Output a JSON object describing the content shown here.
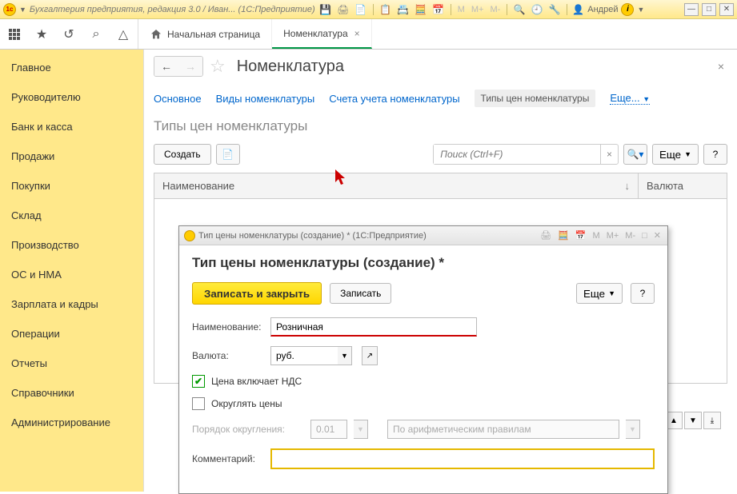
{
  "titlebar": {
    "title": "Бухгалтерия предприятия, редакция 3.0 / Иван...  (1С:Предприятие)",
    "user": "Андрей",
    "m_buttons": [
      "M",
      "M+",
      "M-"
    ]
  },
  "toolbar": {
    "star": "★",
    "search": "⌕",
    "bell": "🔔"
  },
  "tabs": {
    "home": "Начальная страница",
    "active": "Номенклатура"
  },
  "sidebar": {
    "items": [
      "Главное",
      "Руководителю",
      "Банк и касса",
      "Продажи",
      "Покупки",
      "Склад",
      "Производство",
      "ОС и НМА",
      "Зарплата и кадры",
      "Операции",
      "Отчеты",
      "Справочники",
      "Администрирование"
    ]
  },
  "page": {
    "title": "Номенклатура",
    "subnav": {
      "main": "Основное",
      "kinds": "Виды номенклатуры",
      "accounts": "Счета учета номенклатуры",
      "price_types": "Типы цен номенклатуры",
      "more": "Еще..."
    },
    "section_title": "Типы цен номенклатуры",
    "create_btn": "Создать",
    "search_placeholder": "Поиск (Ctrl+F)",
    "more_btn": "Еще",
    "help_btn": "?",
    "col_name": "Наименование",
    "col_currency": "Валюта"
  },
  "dialog": {
    "title": "Тип цены номенклатуры (создание) *  (1С:Предприятие)",
    "heading": "Тип цены номенклатуры (создание) *",
    "save_close": "Записать и закрыть",
    "save": "Записать",
    "more": "Еще",
    "help": "?",
    "name_label": "Наименование:",
    "name_value": "Розничная",
    "currency_label": "Валюта:",
    "currency_value": "руб.",
    "vat_label": "Цена включает НДС",
    "round_label": "Округлять цены",
    "round_order_label": "Порядок округления:",
    "round_value": "0.01",
    "round_rule": "По арифметическим правилам",
    "comment_label": "Комментарий:",
    "comment_value": "",
    "m_buttons": [
      "M",
      "M+",
      "M-"
    ]
  }
}
